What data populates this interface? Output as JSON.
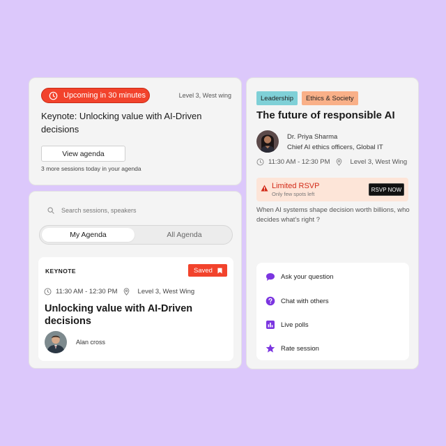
{
  "upcoming": {
    "status_label": "Upcoming in 30 minutes",
    "location": "Level 3, West wing",
    "title": "Keynote: Unlocking value with AI-Driven decisions",
    "button_label": "View agenda",
    "more_sessions": "3 more sessions today in your agenda"
  },
  "agenda": {
    "search_placeholder": "Search sessions, speakers",
    "tabs": [
      {
        "label": "My Agenda",
        "active": true
      },
      {
        "label": "All Agenda",
        "active": false
      }
    ],
    "session": {
      "kicker": "KEYNOTE",
      "saved_label": "Saved",
      "time": "11:30 AM - 12:30 PM",
      "location": "Level 3, West Wing",
      "title": "Unlocking value with AI-Driven decisions",
      "speaker": "Alan cross"
    }
  },
  "detail": {
    "tags": [
      "Leadership",
      "Ethics & Society"
    ],
    "title": "The future of responsible AI",
    "speaker_name": "Dr. Priya Sharma",
    "speaker_role": "Chief AI ethics officers, Global IT",
    "time": "11:30 AM - 12:30 PM",
    "location": "Level 3, West Wing",
    "rsvp": {
      "title": "Limited RSVP",
      "subtitle": "Only few spots left",
      "button": "RSVP NOW"
    },
    "description": "When AI systems shape decision worth billions, who decides what's right ?",
    "actions": [
      {
        "label": "Ask your question",
        "icon": "chat-bubble-icon"
      },
      {
        "label": "Chat with others",
        "icon": "help-circle-icon"
      },
      {
        "label": "Live polls",
        "icon": "bar-chart-icon"
      },
      {
        "label": "Rate session",
        "icon": "star-icon"
      }
    ]
  },
  "colors": {
    "background": "#dcc8fb",
    "accent_red": "#f2432c",
    "accent_purple": "#7b35e0",
    "tag_leadership": "#7fd0d7",
    "tag_ethics": "#f9b088"
  }
}
